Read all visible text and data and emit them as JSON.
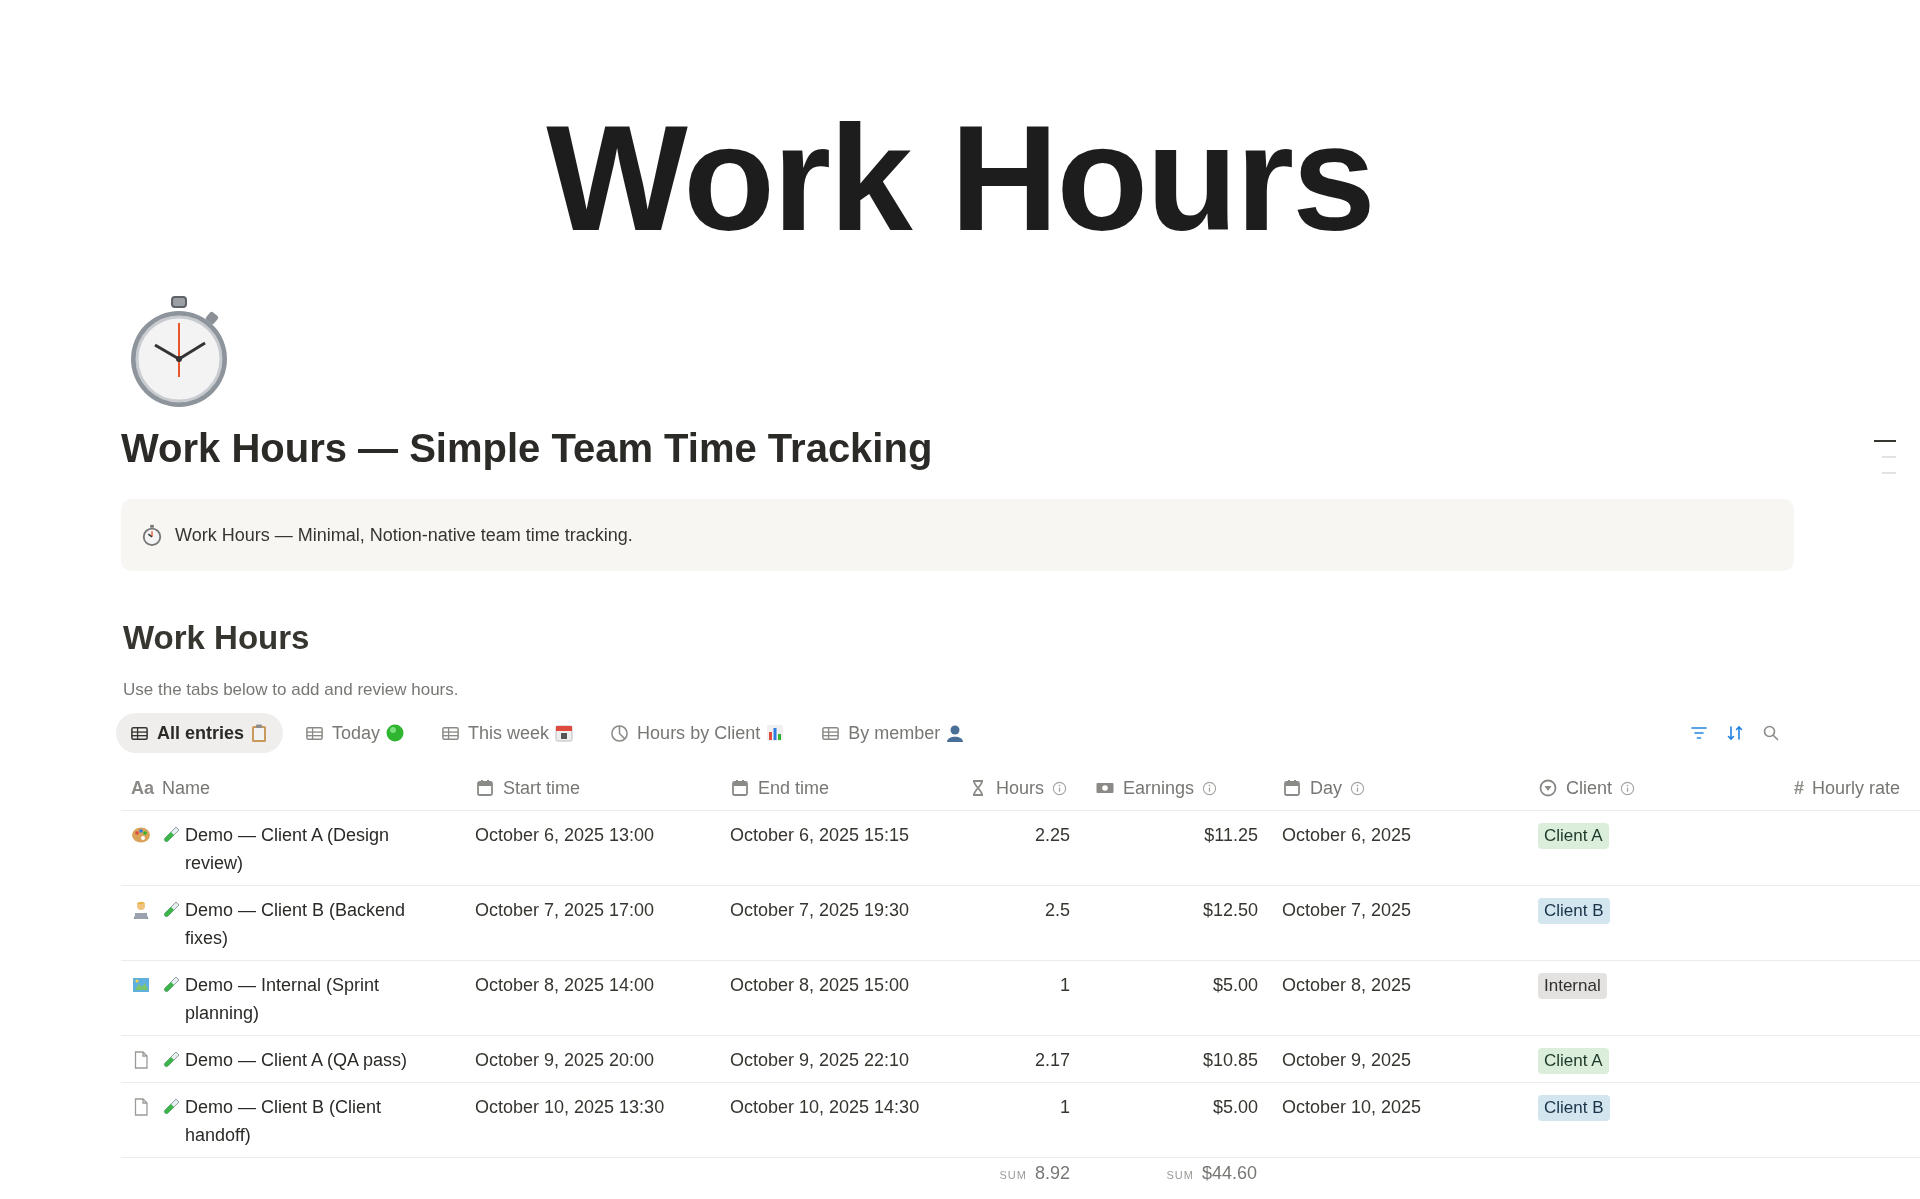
{
  "cover_title": "Work Hours",
  "page_title": "Work Hours — Simple Team Time Tracking",
  "callout": "Work Hours — Minimal, Notion-native team time tracking.",
  "outline": [
    {
      "selected": true
    },
    {
      "selected": false
    },
    {
      "selected": false
    }
  ],
  "database": {
    "title": "Work Hours",
    "description": "Use the tabs below to add and review hours.",
    "tabs": [
      {
        "label": "All entries",
        "kind": "table",
        "emoji": {
          "kind": "clipboard"
        },
        "selected": true
      },
      {
        "label": "Today",
        "kind": "table",
        "emoji": {
          "kind": "green-circle"
        },
        "selected": false
      },
      {
        "label": "This week",
        "kind": "table",
        "emoji": {
          "kind": "calendar"
        },
        "selected": false
      },
      {
        "label": "Hours by Client",
        "kind": "chart",
        "emoji": {
          "kind": "bar-chart"
        },
        "selected": false
      },
      {
        "label": "By member",
        "kind": "table",
        "emoji": {
          "kind": "person"
        },
        "selected": false
      }
    ],
    "toolbar": [
      {
        "kind": "filter",
        "active": true
      },
      {
        "kind": "sort",
        "active": true
      },
      {
        "kind": "search",
        "active": false
      }
    ],
    "columns": [
      {
        "label": "Name",
        "kind": "title",
        "glyph": "Aa",
        "info": false
      },
      {
        "label": "Start time",
        "kind": "date",
        "info": false
      },
      {
        "label": "End time",
        "kind": "date",
        "info": false
      },
      {
        "label": "Hours",
        "kind": "formula",
        "info": true
      },
      {
        "label": "Earnings",
        "kind": "money",
        "info": true
      },
      {
        "label": "Day",
        "kind": "date",
        "info": true
      },
      {
        "label": "Client",
        "kind": "select",
        "info": true
      },
      {
        "label": "Hourly rate",
        "kind": "number",
        "glyph": "#",
        "info": false
      }
    ],
    "rows": [
      {
        "kind": "palette",
        "name": "Demo — Client A (Design review)",
        "start": "October 6, 2025 13:00",
        "end": "October 6, 2025 15:15",
        "hours": "2.25",
        "earnings": "$11.25",
        "day": "October 6, 2025",
        "client": {
          "label": "Client A",
          "color": "#dbeddb"
        }
      },
      {
        "kind": "person",
        "name": "Demo — Client B (Backend fixes)",
        "start": "October 7, 2025 17:00",
        "end": "October 7, 2025 19:30",
        "hours": "2.5",
        "earnings": "$12.50",
        "day": "October 7, 2025",
        "client": {
          "label": "Client B",
          "color": "#d3e5ef"
        }
      },
      {
        "kind": "map",
        "name": "Demo — Internal (Sprint planning)",
        "start": "October 8, 2025 14:00",
        "end": "October 8, 2025 15:00",
        "hours": "1",
        "earnings": "$5.00",
        "day": "October 8, 2025",
        "client": {
          "label": "Internal",
          "color": "#e3e2e0"
        }
      },
      {
        "kind": "page",
        "name": "Demo — Client A (QA pass)",
        "start": "October 9, 2025 20:00",
        "end": "October 9, 2025 22:10",
        "hours": "2.17",
        "earnings": "$10.85",
        "day": "October 9, 2025",
        "client": {
          "label": "Client A",
          "color": "#dbeddb"
        }
      },
      {
        "kind": "page",
        "name": "Demo — Client B (Client handoff)",
        "start": "October 10, 2025 13:30",
        "end": "October 10, 2025 14:30",
        "hours": "1",
        "earnings": "$5.00",
        "day": "October 10, 2025",
        "client": {
          "label": "Client B",
          "color": "#d3e5ef"
        }
      }
    ],
    "sums": {
      "hours": {
        "label": "SUM",
        "value": "8.92"
      },
      "earnings": {
        "label": "SUM",
        "value": "$44.60"
      }
    }
  }
}
